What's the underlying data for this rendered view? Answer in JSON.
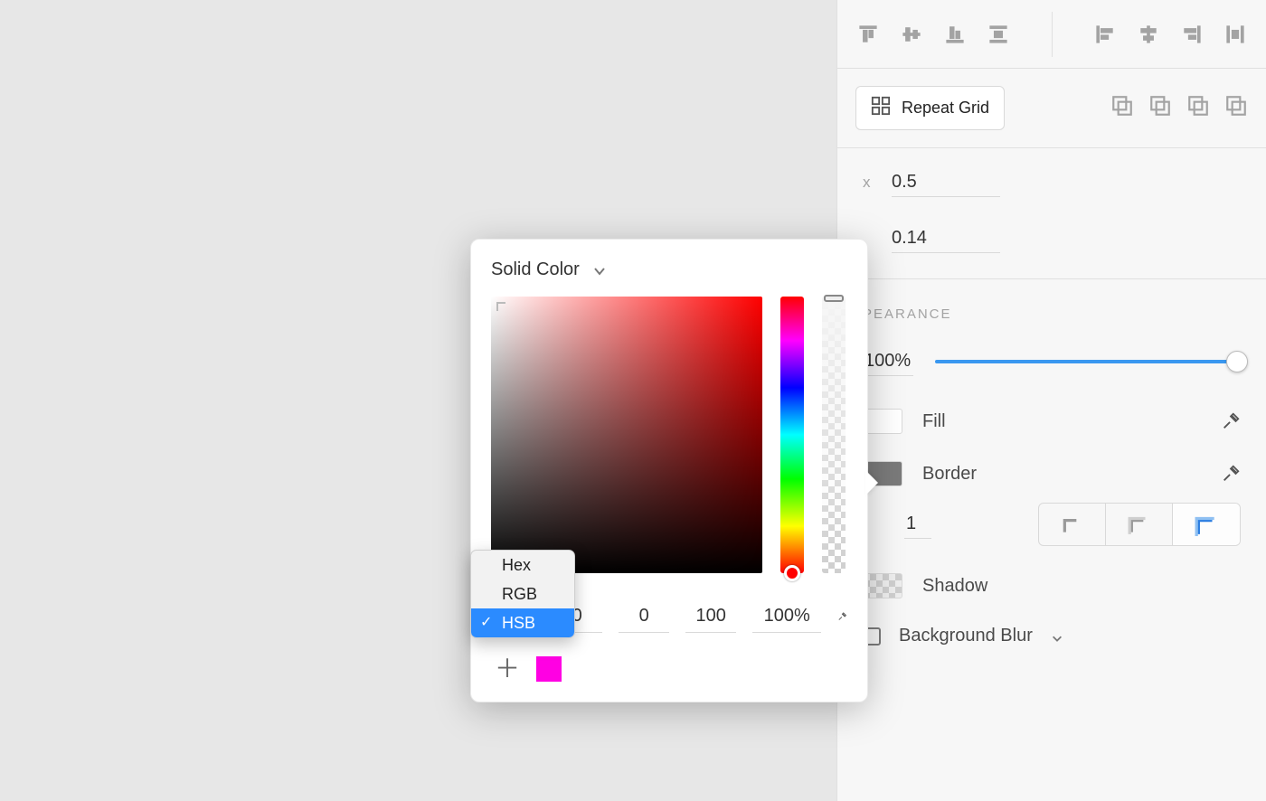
{
  "inspector": {
    "repeat_grid_label": "Repeat Grid",
    "position": {
      "x_axis_label": "X",
      "x_value": "0.5",
      "y_value": "0.14"
    },
    "appearance": {
      "section_title": "PEARANCE",
      "opacity_value": "100%",
      "fill": {
        "label": "Fill",
        "checked": true,
        "swatch_color": "#ffffff"
      },
      "border": {
        "label": "Border",
        "checked": true,
        "swatch_color": "#7a7a7a",
        "size": "1"
      },
      "shadow": {
        "label": "Shadow",
        "checked": false
      },
      "background_blur": {
        "label": "Background Blur",
        "checked": false
      }
    }
  },
  "color_picker": {
    "mode_label": "Solid Color",
    "values": {
      "h": "0",
      "s": "0",
      "b": "100",
      "a": "100%"
    },
    "saved_swatches": [
      "#ff00e3"
    ],
    "color_modes": {
      "options": [
        "Hex",
        "RGB",
        "HSB"
      ],
      "selected": "HSB"
    }
  }
}
